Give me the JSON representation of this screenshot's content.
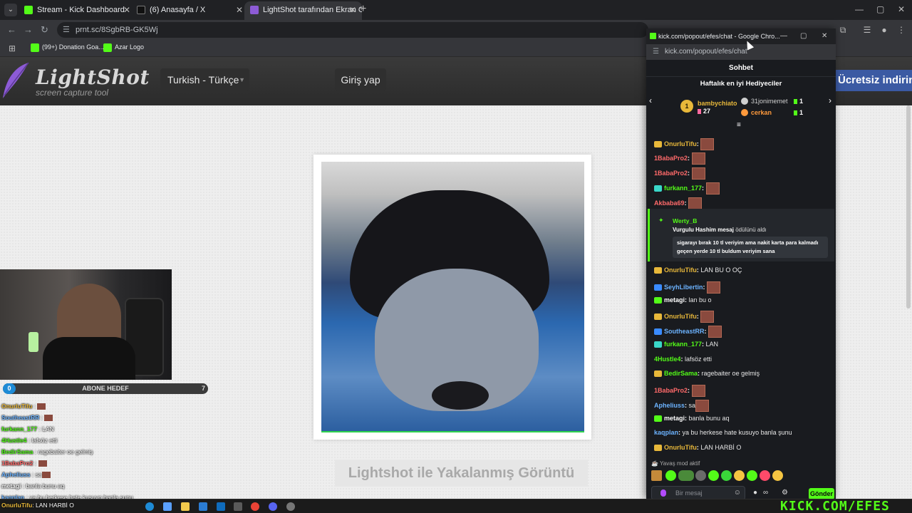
{
  "tabs": [
    {
      "label": "Stream - Kick Dashboard",
      "color": "#53fc18"
    },
    {
      "label": "(6) Anasayfa / X",
      "color": "#111111"
    },
    {
      "label": "LightShot tarafından Ekran Görü",
      "color": "#8d5bd6"
    }
  ],
  "address": "prnt.sc/8SgbRB-GK5Wj",
  "bookmarks": [
    {
      "label": "(99+) Donation Goa...",
      "color": "#53fc18"
    },
    {
      "label": "Azar Logo",
      "color": "#53fc18"
    }
  ],
  "lightshot": {
    "logo": "LightShot",
    "tagline": "screen capture tool",
    "language": "Turkish - Türkçe",
    "login": "Giriş yap",
    "download": "Ücretsiz indirin",
    "caption": "Lightshot ile Yakalanmış Görüntü"
  },
  "overlay": {
    "sub_goal": {
      "start": "0",
      "title": "ABONE HEDEF",
      "end": "7",
      "progress": 0
    },
    "chat": [
      {
        "user": "OnurluTifu",
        "text": "",
        "color": "#e8b83a",
        "emote": true
      },
      {
        "user": "SoutheastRR",
        "text": "",
        "color": "#6cb3ff",
        "emote": true
      },
      {
        "user": "furkann_177",
        "text": "LAN",
        "color": "#53fc18",
        "emote": false
      },
      {
        "user": "4Hustle4",
        "text": "lafsöz etti",
        "color": "#53fc18",
        "emote": false
      },
      {
        "user": "BedirSama",
        "text": "ragebaiter oe gelmiş",
        "color": "#53fc18",
        "emote": false
      },
      {
        "user": "1BabaPro2",
        "text": "",
        "color": "#ff6a6a",
        "emote": true
      },
      {
        "user": "Apheliuss",
        "text": "sa",
        "color": "#6cb3ff",
        "emote": true
      },
      {
        "user": "metagi",
        "text": "banla bunu aq",
        "color": "#fff",
        "emote": false
      },
      {
        "user": "kaqplan",
        "text": "ya bu herkese hate kusuyo banla şunu",
        "color": "#6cb3ff",
        "emote": false
      }
    ]
  },
  "popup": {
    "title": "kick.com/popout/efes/chat - Google Chro...",
    "url": "kick.com/popout/efes/chat",
    "header": "Sohbet",
    "gifters_title": "Haftalık en iyi Hediyeciler",
    "top_gifter": {
      "rank": "1",
      "name": "bambychiato",
      "count": "27"
    },
    "gifters": [
      {
        "name": "31jonimemet",
        "count": "1",
        "color": "#cfcfcf"
      },
      {
        "name": "cerkan",
        "count": "1",
        "color": "#ff9a3c"
      }
    ],
    "messages": [
      {
        "user": "OnurluTifu",
        "text": "",
        "color": "#e8b83a",
        "badge": "#e8b83a",
        "emote": true
      },
      {
        "user": "1BabaPro2",
        "text": "",
        "color": "#ff6a6a",
        "badge": "",
        "emote": true
      },
      {
        "user": "1BabaPro2",
        "text": "",
        "color": "#ff6a6a",
        "badge": "",
        "emote": true
      },
      {
        "user": "furkann_177",
        "text": "",
        "color": "#53fc18",
        "badge": "#3ad7c9",
        "emote": true
      },
      {
        "user": "Akbaba69",
        "text": "",
        "color": "#ff6a6a",
        "badge": "",
        "emote": true
      }
    ],
    "reward": {
      "user": "Werty_B",
      "reward_name": "Vurgulu Hashim mesaj",
      "reward_suffix": "ödülünü aldı",
      "message": "sigarayı bırak 10 tl veriyim ama nakit karta para kalmadı geçen yerde 10 tl buldum veriyim sana"
    },
    "messages2": [
      {
        "user": "OnurluTifu",
        "text": "LAN BU O OÇ",
        "color": "#e8b83a",
        "badge": "#e8b83a",
        "emote": false
      },
      {
        "user": "SeyhLibertin",
        "text": "",
        "color": "#6cb3ff",
        "badge": "#3a8bff",
        "emote": true
      },
      {
        "user": "metagi",
        "text": "lan bu o",
        "color": "#fff",
        "badge": "#53fc18",
        "emote": false
      },
      {
        "user": "OnurluTifu",
        "text": "",
        "color": "#e8b83a",
        "badge": "#e8b83a",
        "emote": true
      },
      {
        "user": "SoutheastRR",
        "text": "",
        "color": "#6cb3ff",
        "badge": "#3a8bff",
        "emote": true
      },
      {
        "user": "furkann_177",
        "text": "LAN",
        "color": "#53fc18",
        "badge": "#3ad7c9",
        "emote": false
      },
      {
        "user": "4Hustle4",
        "text": "lafsöz etti",
        "color": "#53fc18",
        "badge": "",
        "emote": false
      },
      {
        "user": "BedirSama",
        "text": "ragebaiter oe gelmiş",
        "color": "#53fc18",
        "badge": "#e8b83a",
        "emote": false
      },
      {
        "user": "1BabaPro2",
        "text": "",
        "color": "#ff6a6a",
        "badge": "",
        "emote": true
      },
      {
        "user": "Apheliuss",
        "text": "sa",
        "color": "#6cb3ff",
        "badge": "",
        "emote": true
      },
      {
        "user": "metagi",
        "text": "banla bunu aq",
        "color": "#fff",
        "badge": "#53fc18",
        "emote": false
      },
      {
        "user": "kaqplan",
        "text": "ya bu herkese hate kusuyo banla şunu",
        "color": "#6cb3ff",
        "badge": "",
        "emote": false
      },
      {
        "user": "OnurluTifu",
        "text": "LAN HARBİ O",
        "color": "#e8b83a",
        "badge": "#e8b83a",
        "emote": false
      }
    ],
    "slow_mode": "Yavaş mod aktif",
    "input_placeholder": "Bir mesaj",
    "send": "Gönder"
  },
  "taskbar": {
    "ticker_user": "OnurluTifu",
    "ticker_text": "LAN HARBİ O",
    "brand": "KICK.COM/EFES"
  }
}
